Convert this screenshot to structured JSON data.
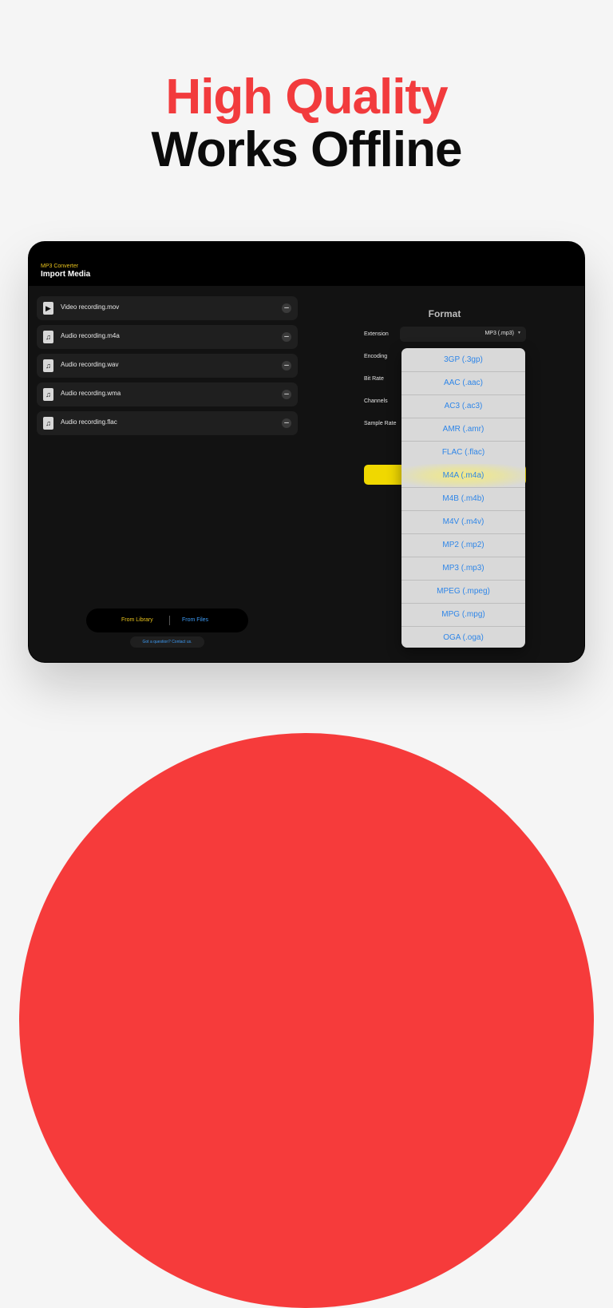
{
  "headline": {
    "line1": "High Quality",
    "line2": "Works Offline"
  },
  "app": {
    "name": "MP3 Converter",
    "title": "Import Media"
  },
  "files": [
    {
      "name": "Video recording.mov",
      "icon": "play-icon"
    },
    {
      "name": "Audio recording.m4a",
      "icon": "music-note-icon"
    },
    {
      "name": "Audio recording.wav",
      "icon": "music-note-icon"
    },
    {
      "name": "Audio recording.wma",
      "icon": "music-note-icon"
    },
    {
      "name": "Audio recording.flac",
      "icon": "music-note-icon"
    }
  ],
  "import_sources": {
    "library": "From Library",
    "files": "From Files"
  },
  "contact": "Got a question? Contact us.",
  "format": {
    "title": "Format",
    "labels": [
      "Extension",
      "Encoding",
      "Bit Rate",
      "Channels",
      "Sample Rate"
    ],
    "extension_value": "MP3 (.mp3)"
  },
  "dropdown_options": [
    "3GP (.3gp)",
    "AAC (.aac)",
    "AC3 (.ac3)",
    "AMR (.amr)",
    "FLAC (.flac)",
    "M4A (.m4a)",
    "M4B (.m4b)",
    "M4V (.m4v)",
    "MP2 (.mp2)",
    "MP3 (.mp3)",
    "MPEG (.mpeg)",
    "MPG (.mpg)",
    "OGA (.oga)"
  ],
  "colors": {
    "accent_yellow": "#f0d800",
    "brand_red": "#f23b3d",
    "link_blue": "#2f86e8"
  }
}
